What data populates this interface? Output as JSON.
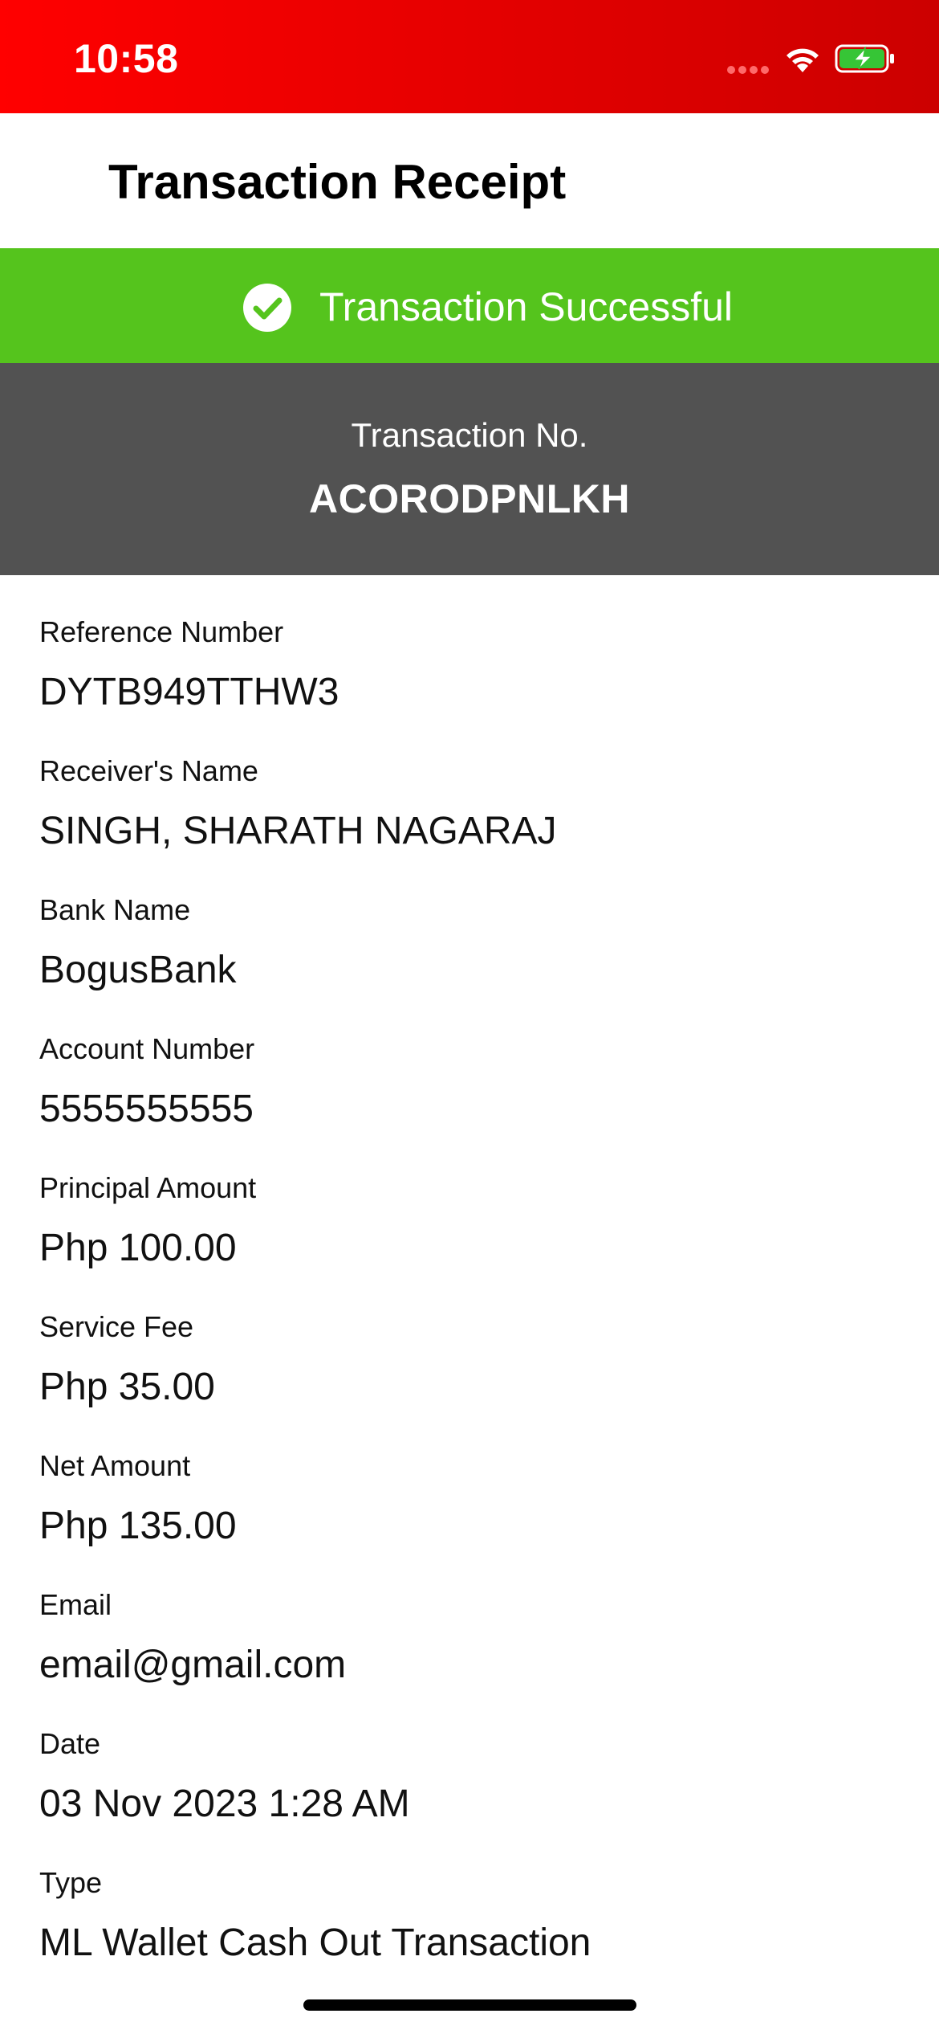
{
  "status_bar": {
    "time": "10:58"
  },
  "header": {
    "title": "Transaction Receipt"
  },
  "banner": {
    "text": "Transaction Successful",
    "color": "#55c41d"
  },
  "transaction": {
    "label": "Transaction No.",
    "number": "ACORODPNLKH"
  },
  "fields": [
    {
      "label": "Reference Number",
      "value": "DYTB949TTHW3"
    },
    {
      "label": "Receiver's Name",
      "value": "SINGH, SHARATH NAGARAJ"
    },
    {
      "label": "Bank Name",
      "value": "BogusBank"
    },
    {
      "label": "Account Number",
      "value": "5555555555"
    },
    {
      "label": "Principal Amount",
      "value": "Php 100.00"
    },
    {
      "label": "Service Fee",
      "value": "Php 35.00"
    },
    {
      "label": "Net Amount",
      "value": "Php 135.00"
    },
    {
      "label": "Email",
      "value": "email@gmail.com"
    },
    {
      "label": "Date",
      "value": "03 Nov 2023 1:28 AM"
    },
    {
      "label": "Type",
      "value": "ML Wallet Cash Out Transaction"
    }
  ],
  "colors": {
    "status_bar": "#e00000",
    "transaction_block": "#525252"
  }
}
